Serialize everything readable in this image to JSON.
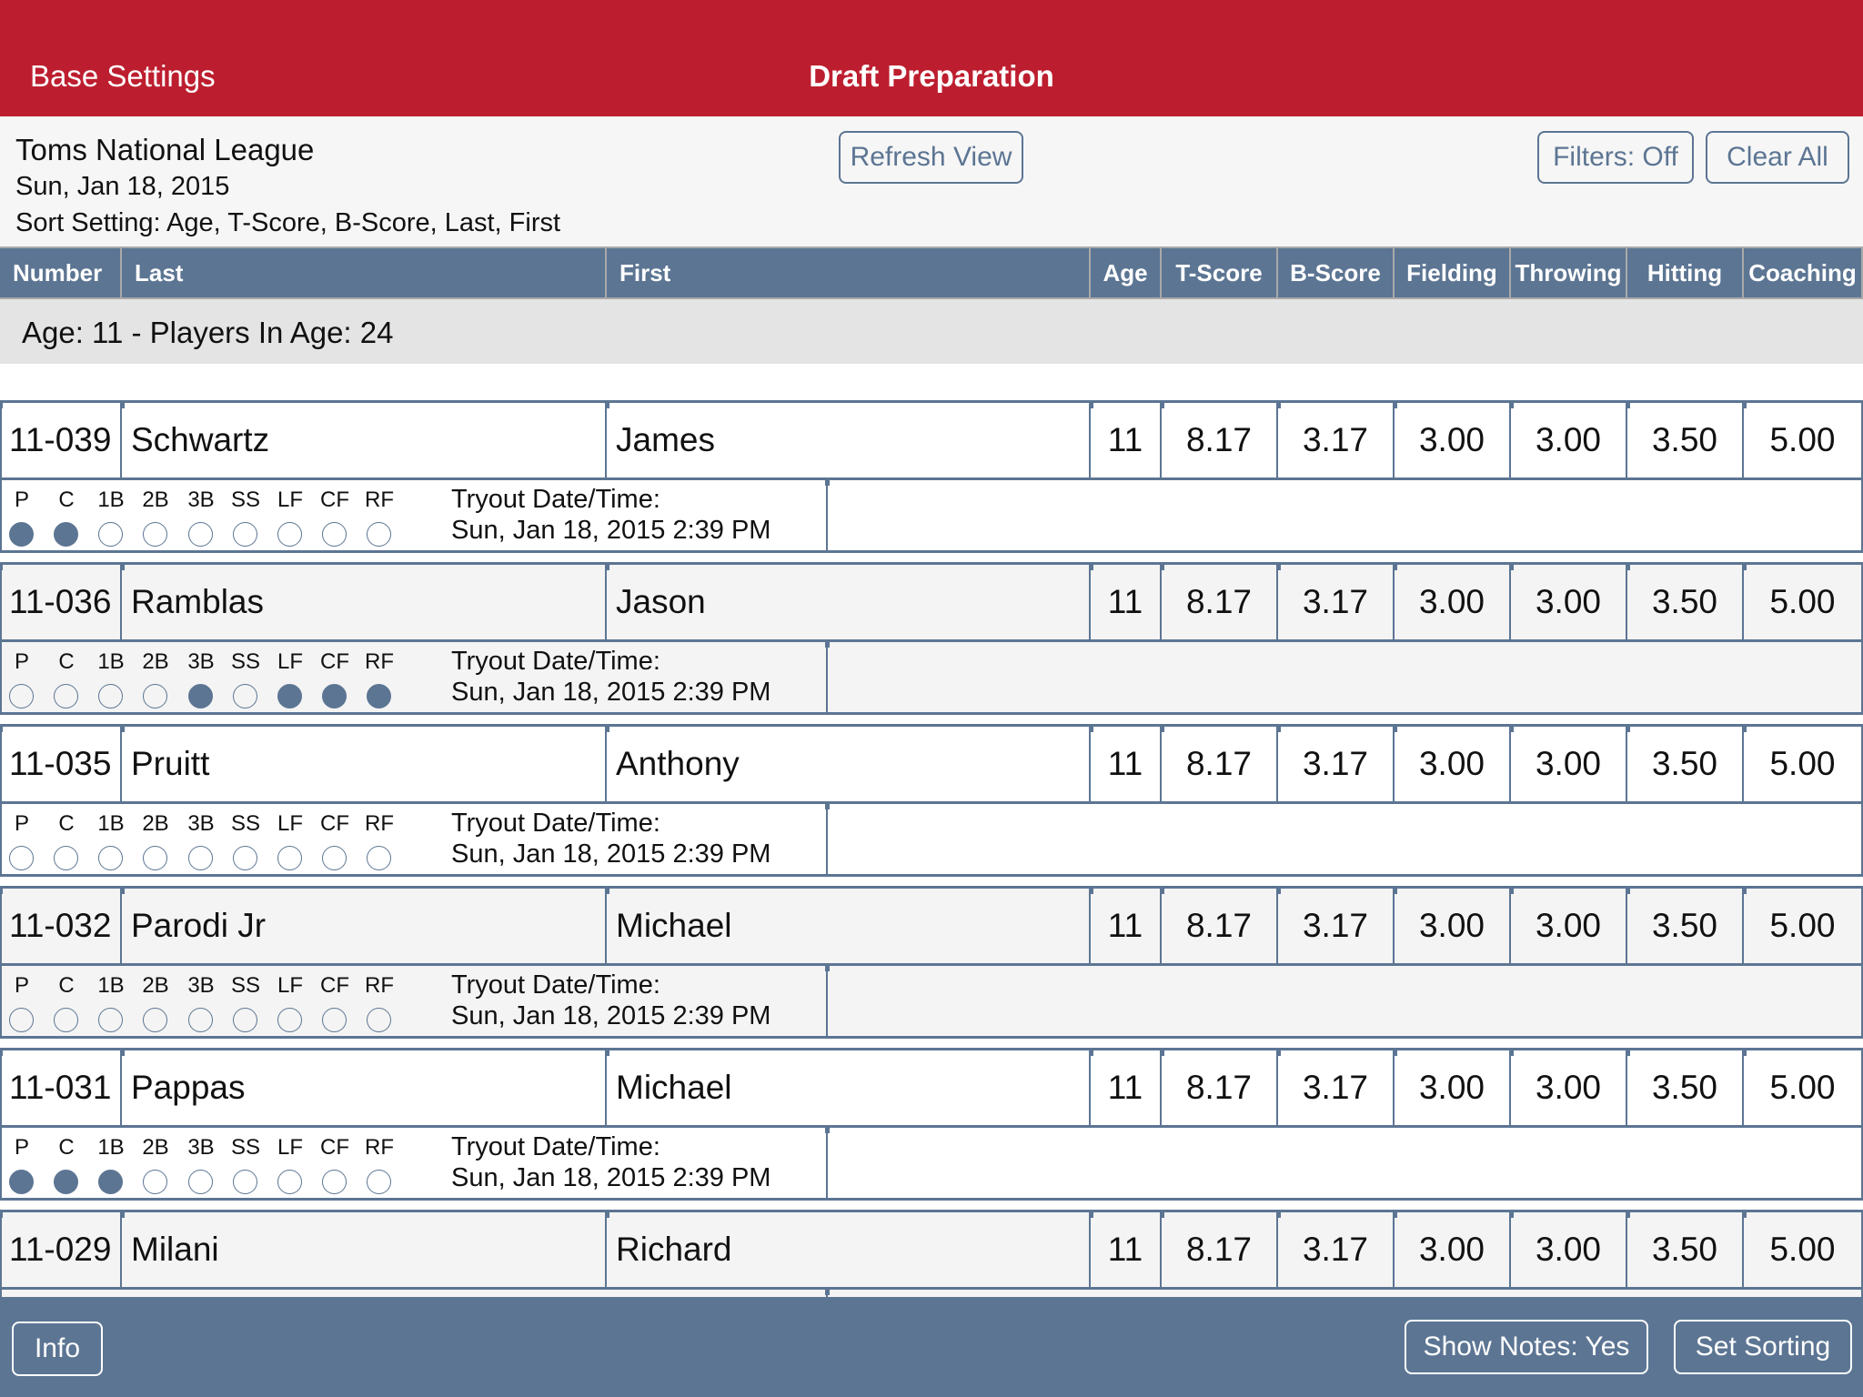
{
  "navbar": {
    "back_label": "Base Settings",
    "title": "Draft Preparation",
    "color": "#bd1e2f"
  },
  "header": {
    "league": "Toms National League",
    "date": "Sun, Jan 18, 2015",
    "sort_setting": "Sort Setting: Age, T-Score, B-Score, Last, First",
    "refresh_label": "Refresh View",
    "filters_label": "Filters: Off",
    "clear_label": "Clear All"
  },
  "columns": [
    "Number",
    "Last",
    "First",
    "Age",
    "T-Score",
    "B-Score",
    "Fielding",
    "Throwing",
    "Hitting",
    "Coaching"
  ],
  "group": {
    "label": "Age: 11 - Players In Age: 24"
  },
  "positions": [
    "P",
    "C",
    "1B",
    "2B",
    "3B",
    "SS",
    "LF",
    "CF",
    "RF"
  ],
  "tryout_label": "Tryout Date/Time:",
  "partial_row": {
    "positions_selected": [
      false,
      false,
      false,
      false,
      false,
      false,
      false,
      false,
      false
    ],
    "tryout": "Sun, Jan 18, 2015 2:39 PM"
  },
  "players": [
    {
      "number": "11-039",
      "last": "Schwartz",
      "first": "James",
      "age": "11",
      "t_score": "8.17",
      "b_score": "3.17",
      "fielding": "3.00",
      "throwing": "3.00",
      "hitting": "3.50",
      "coaching": "5.00",
      "positions_selected": [
        true,
        true,
        false,
        false,
        false,
        false,
        false,
        false,
        false
      ],
      "tryout": "Sun, Jan 18, 2015 2:39 PM"
    },
    {
      "number": "11-036",
      "last": "Ramblas",
      "first": "Jason",
      "age": "11",
      "t_score": "8.17",
      "b_score": "3.17",
      "fielding": "3.00",
      "throwing": "3.00",
      "hitting": "3.50",
      "coaching": "5.00",
      "positions_selected": [
        false,
        false,
        false,
        false,
        true,
        false,
        true,
        true,
        true
      ],
      "tryout": "Sun, Jan 18, 2015 2:39 PM"
    },
    {
      "number": "11-035",
      "last": "Pruitt",
      "first": "Anthony",
      "age": "11",
      "t_score": "8.17",
      "b_score": "3.17",
      "fielding": "3.00",
      "throwing": "3.00",
      "hitting": "3.50",
      "coaching": "5.00",
      "positions_selected": [
        false,
        false,
        false,
        false,
        false,
        false,
        false,
        false,
        false
      ],
      "tryout": "Sun, Jan 18, 2015 2:39 PM"
    },
    {
      "number": "11-032",
      "last": "Parodi Jr",
      "first": "Michael",
      "age": "11",
      "t_score": "8.17",
      "b_score": "3.17",
      "fielding": "3.00",
      "throwing": "3.00",
      "hitting": "3.50",
      "coaching": "5.00",
      "positions_selected": [
        false,
        false,
        false,
        false,
        false,
        false,
        false,
        false,
        false
      ],
      "tryout": "Sun, Jan 18, 2015 2:39 PM"
    },
    {
      "number": "11-031",
      "last": "Pappas",
      "first": "Michael",
      "age": "11",
      "t_score": "8.17",
      "b_score": "3.17",
      "fielding": "3.00",
      "throwing": "3.00",
      "hitting": "3.50",
      "coaching": "5.00",
      "positions_selected": [
        true,
        true,
        true,
        false,
        false,
        false,
        false,
        false,
        false
      ],
      "tryout": "Sun, Jan 18, 2015 2:39 PM"
    },
    {
      "number": "11-029",
      "last": "Milani",
      "first": "Richard",
      "age": "11",
      "t_score": "8.17",
      "b_score": "3.17",
      "fielding": "3.00",
      "throwing": "3.00",
      "hitting": "3.50",
      "coaching": "5.00",
      "positions_selected": [
        false,
        false,
        false,
        false,
        false,
        false,
        false,
        false,
        false
      ],
      "tryout": ""
    }
  ],
  "toolbar": {
    "info_label": "Info",
    "notes_label": "Show Notes: Yes",
    "sorting_label": "Set Sorting",
    "color": "#5c7593"
  }
}
